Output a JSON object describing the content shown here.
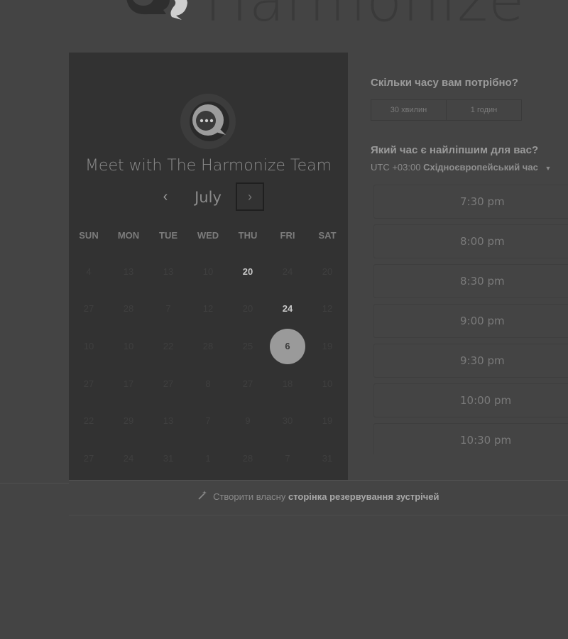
{
  "brand": {
    "name": "Harmonize"
  },
  "calendar": {
    "team_title": "Meet with The Harmonize Team",
    "month": "July",
    "prev_icon": "‹",
    "next_icon": "›",
    "weekdays": [
      "SUN",
      "MON",
      "TUE",
      "WED",
      "THU",
      "FRI",
      "SAT"
    ],
    "weeks": [
      [
        "4",
        "13",
        "13",
        "10",
        "20",
        "24",
        "20"
      ],
      [
        "27",
        "28",
        "7",
        "12",
        "20",
        "24",
        "12"
      ],
      [
        "10",
        "10",
        "22",
        "28",
        "25",
        "6",
        "19"
      ],
      [
        "27",
        "17",
        "27",
        "8",
        "27",
        "18",
        "10"
      ],
      [
        "22",
        "29",
        "13",
        "7",
        "9",
        "30",
        "19"
      ],
      [
        "27",
        "24",
        "31",
        "1",
        "28",
        "7",
        "31"
      ]
    ],
    "available_days": [
      [
        0,
        4
      ],
      [
        1,
        5
      ]
    ],
    "selected_day": [
      2,
      5
    ]
  },
  "duration": {
    "heading": "Скільки часу вам потрібно?",
    "options": [
      "30 хвилин",
      "1 годин"
    ]
  },
  "time": {
    "heading": "Який час є найліпшим для вас?",
    "timezone_prefix": "UTC +03:00",
    "timezone_name": "Східноєвропейський час",
    "slots": [
      "7:30 pm",
      "8:00 pm",
      "8:30 pm",
      "9:00 pm",
      "9:30 pm",
      "10:00 pm",
      "10:30 pm"
    ]
  },
  "footer": {
    "text": "Створити власну",
    "link": "сторінка резервування зустрічей"
  }
}
